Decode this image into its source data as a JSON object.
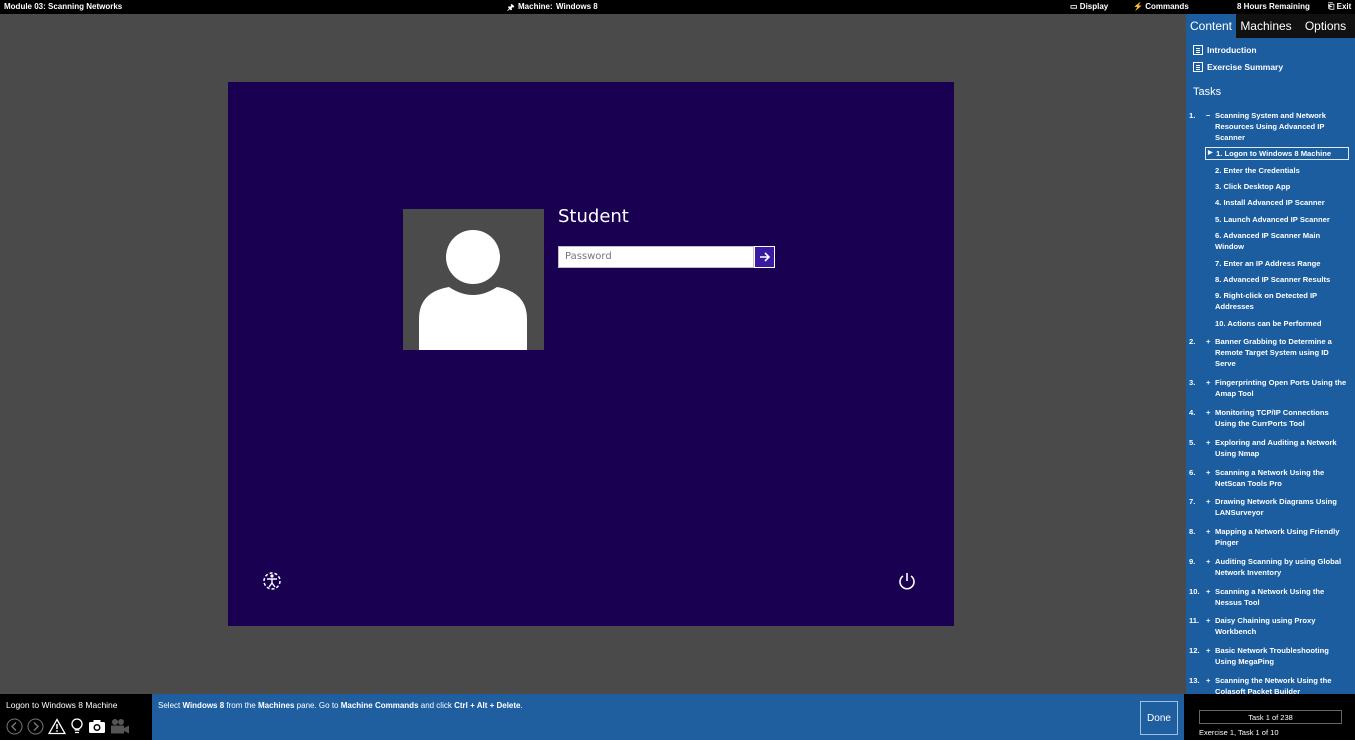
{
  "topbar": {
    "module": "Module 03: Scanning Networks",
    "machine_label": "Machine:",
    "machine_name": "Windows 8",
    "display": "Display",
    "commands": "Commands",
    "time_remaining": "8 Hours Remaining",
    "exit": "Exit"
  },
  "vm": {
    "username": "Student",
    "password_placeholder": "Password"
  },
  "panel": {
    "tabs": [
      "Content",
      "Machines",
      "Options"
    ],
    "intro": "Introduction",
    "summary": "Exercise Summary",
    "tasks_heading": "Tasks",
    "tasks": [
      {
        "num": "1.",
        "sign": "−",
        "label": "Scanning System and Network Resources Using Advanced IP Scanner"
      },
      {
        "num": "2.",
        "sign": "+",
        "label": "Banner Grabbing to Determine a Remote Target System using ID Serve"
      },
      {
        "num": "3.",
        "sign": "+",
        "label": "Fingerprinting Open Ports Using the Amap Tool"
      },
      {
        "num": "4.",
        "sign": "+",
        "label": "Monitoring TCP/IP Connections Using the CurrPorts Tool"
      },
      {
        "num": "5.",
        "sign": "+",
        "label": "Exploring and Auditing a Network Using Nmap"
      },
      {
        "num": "6.",
        "sign": "+",
        "label": "Scanning a Network Using the NetScan Tools Pro"
      },
      {
        "num": "7.",
        "sign": "+",
        "label": "Drawing Network Diagrams Using LANSurveyor"
      },
      {
        "num": "8.",
        "sign": "+",
        "label": "Mapping a Network Using Friendly Pinger"
      },
      {
        "num": "9.",
        "sign": "+",
        "label": "Auditing Scanning by using Global Network Inventory"
      },
      {
        "num": "10.",
        "sign": "+",
        "label": "Scanning a Network Using the Nessus Tool"
      },
      {
        "num": "11.",
        "sign": "+",
        "label": "Daisy Chaining using Proxy Workbench"
      },
      {
        "num": "12.",
        "sign": "+",
        "label": "Basic Network Troubleshooting Using MegaPing"
      },
      {
        "num": "13.",
        "sign": "+",
        "label": "Scanning the Network Using the Colasoft Packet Builder"
      }
    ],
    "subtasks": [
      "1. Logon to Windows 8 Machine",
      "2. Enter the Credentials",
      "3. Click Desktop App",
      "4. Install Advanced IP Scanner",
      "5. Launch Advanced IP Scanner",
      "6. Advanced IP Scanner Main Window",
      "7. Enter an IP Address Range",
      "8. Advanced IP Scanner Results",
      "9. Right-click on Detected IP Addresses",
      "10. Actions can be Performed"
    ]
  },
  "bottom": {
    "current_task": "Logon to Windows 8 Machine",
    "instr": {
      "p1": "Select ",
      "b1": "Windows 8",
      "p2": " from the ",
      "b2": "Machines",
      "p3": " pane. Go to ",
      "b3": "Machine Commands",
      "p4": " and click ",
      "b4": "Ctrl + Alt + Delete",
      "p5": "."
    },
    "done": "Done",
    "task_count": "Task 1 of 238",
    "exercise_info": "Exercise 1, Task 1 of 10"
  }
}
